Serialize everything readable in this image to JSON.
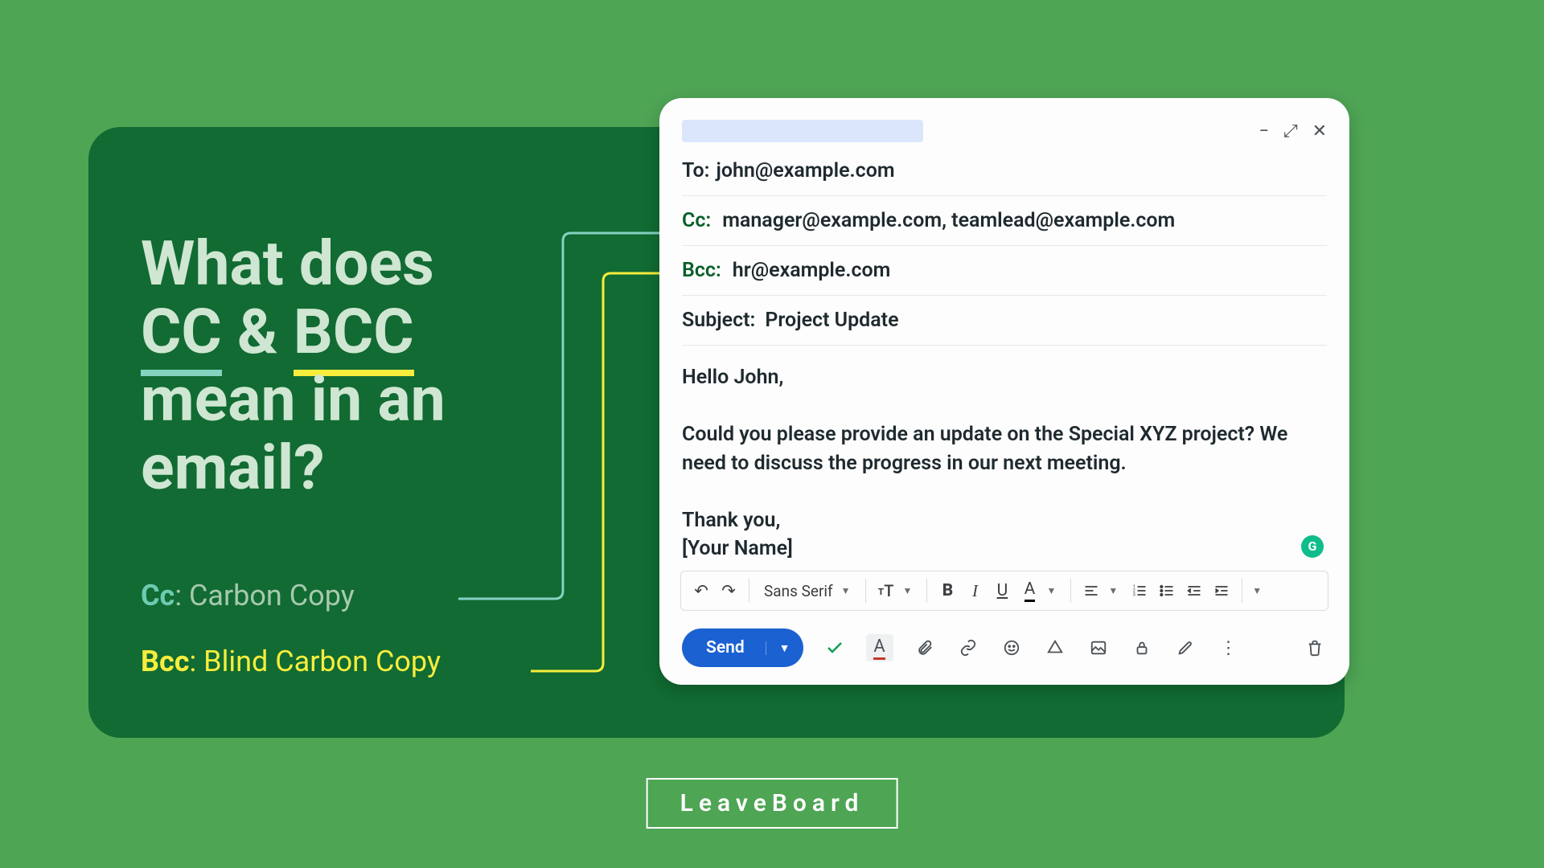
{
  "headline": {
    "line1": "What does",
    "cc": "CC",
    "amp": " & ",
    "bcc": "BCC",
    "line3a": "mean in an",
    "line3b": "email?"
  },
  "definitions": {
    "cc_label": "Cc",
    "cc_text": ": Carbon Copy",
    "bcc_label": "Bcc",
    "bcc_text": ": Blind Carbon Copy"
  },
  "compose": {
    "to_label": "To:",
    "to_value": "john@example.com",
    "cc_label": "Cc:",
    "cc_value": "manager@example.com, teamlead@example.com",
    "bcc_label": "Bcc:",
    "bcc_value": "hr@example.com",
    "subject_label": "Subject:",
    "subject_value": "Project Update",
    "greeting": "Hello John,",
    "body": "Could you please provide an update on the Special XYZ project? We need to discuss the progress in our next meeting.",
    "thanks": "Thank you,",
    "signature": "[Your Name]",
    "font": "Sans Serif",
    "send": "Send"
  },
  "brand": "LeaveBoard"
}
